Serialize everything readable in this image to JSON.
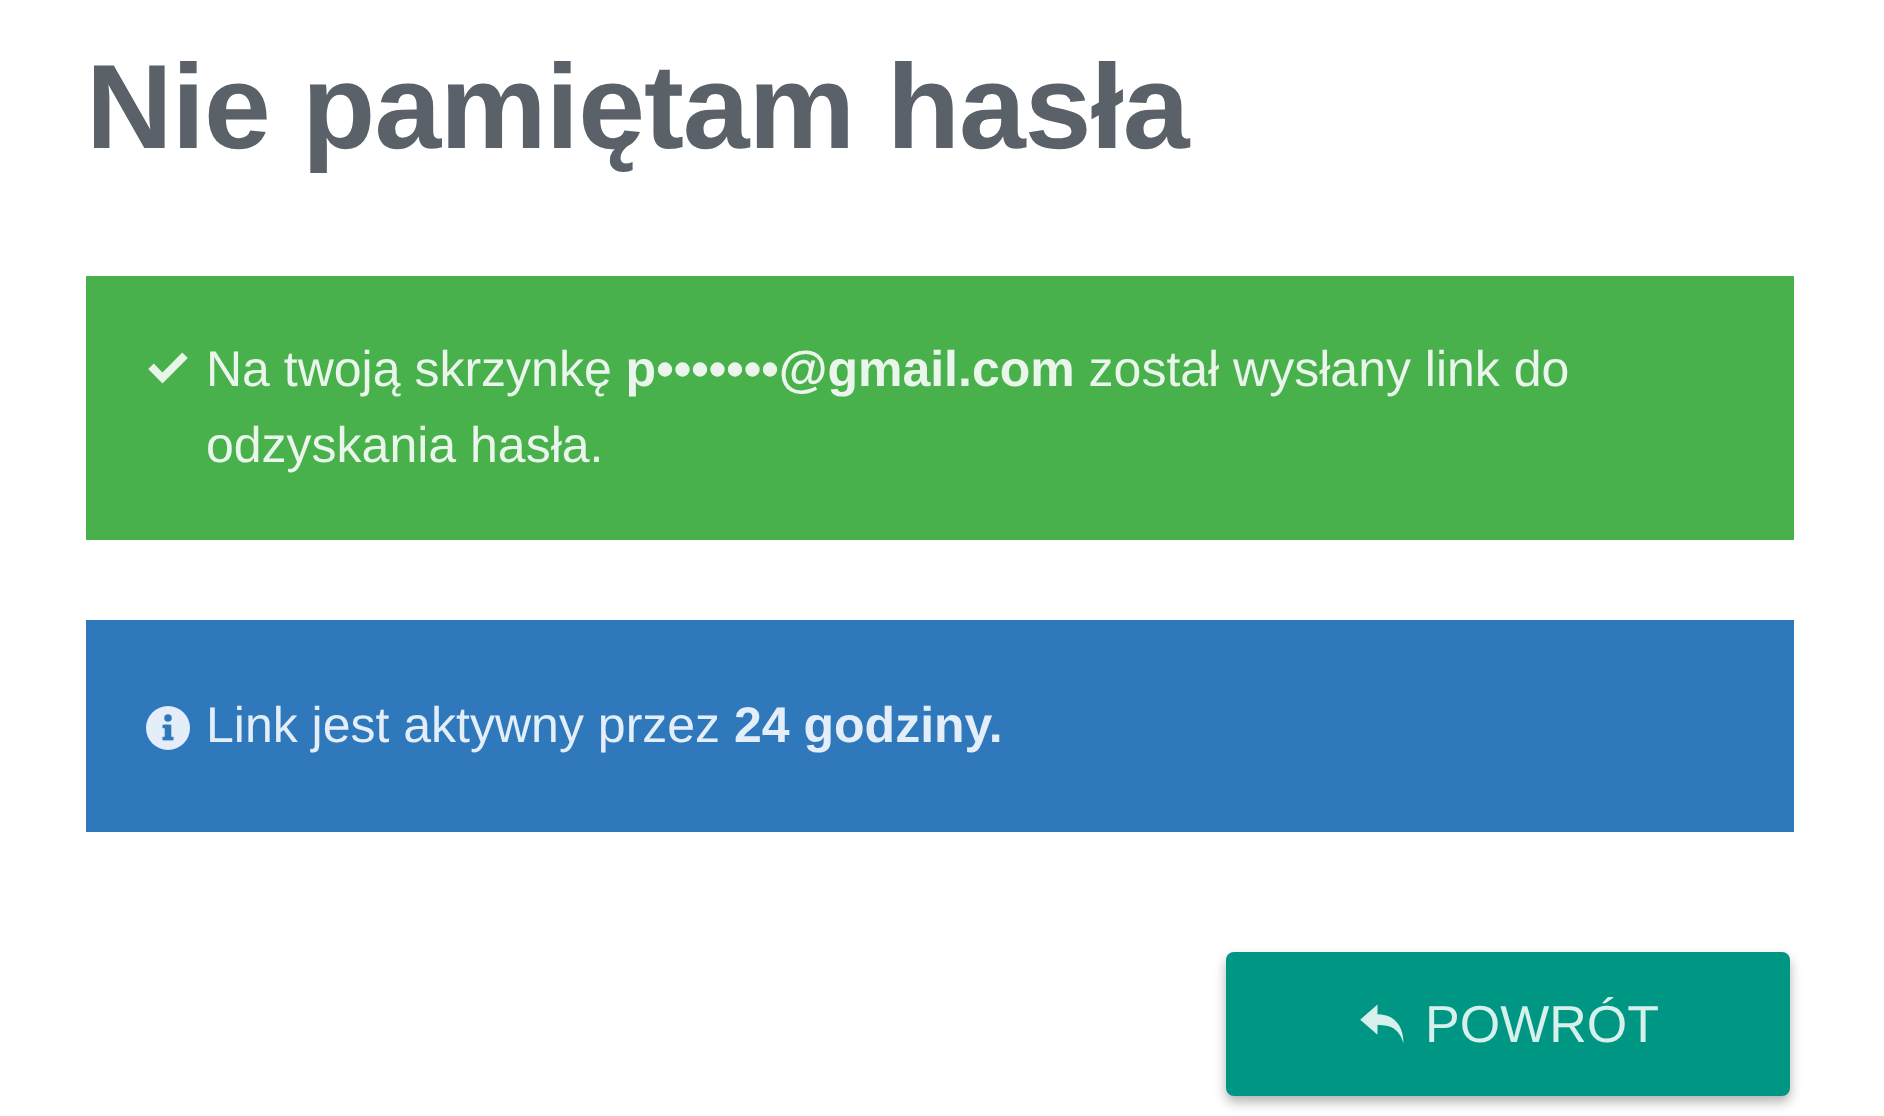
{
  "title": "Nie pamiętam hasła",
  "alerts": [
    {
      "kind": "success",
      "text": "Na twoją skrzynkę **p•••••••@gmail.com** został wysłany link do odzyskania hasła."
    },
    {
      "kind": "info",
      "text": "Link jest aktywny przez **24 godziny.**"
    }
  ],
  "button": {
    "label": "POWRÓT"
  }
}
